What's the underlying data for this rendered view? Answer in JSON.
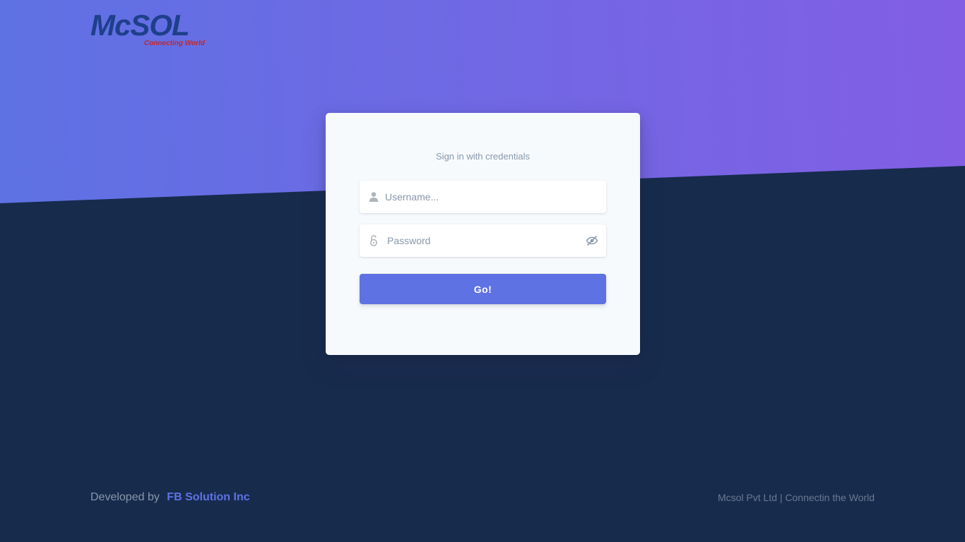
{
  "brand": {
    "name": "McSOL",
    "tagline": "Connecting World"
  },
  "login": {
    "title": "Sign in with credentials",
    "username_placeholder": "Username...",
    "password_placeholder": "Password",
    "submit_label": "Go!"
  },
  "footer": {
    "developed_by_label": "Developed by",
    "developer_link": "FB Solution Inc",
    "copyright": "Mcsol Pvt Ltd | Connectin the World"
  },
  "icons": {
    "username": "user-icon",
    "password": "lock-open-icon",
    "toggle_password": "eye-slash-icon"
  },
  "colors": {
    "primary": "#5e72e4",
    "gradient_end": "#825ee4",
    "background": "#172b4d",
    "card": "#f7fafc",
    "logo_blue": "#1e3f8a",
    "logo_red": "#c0272d"
  }
}
